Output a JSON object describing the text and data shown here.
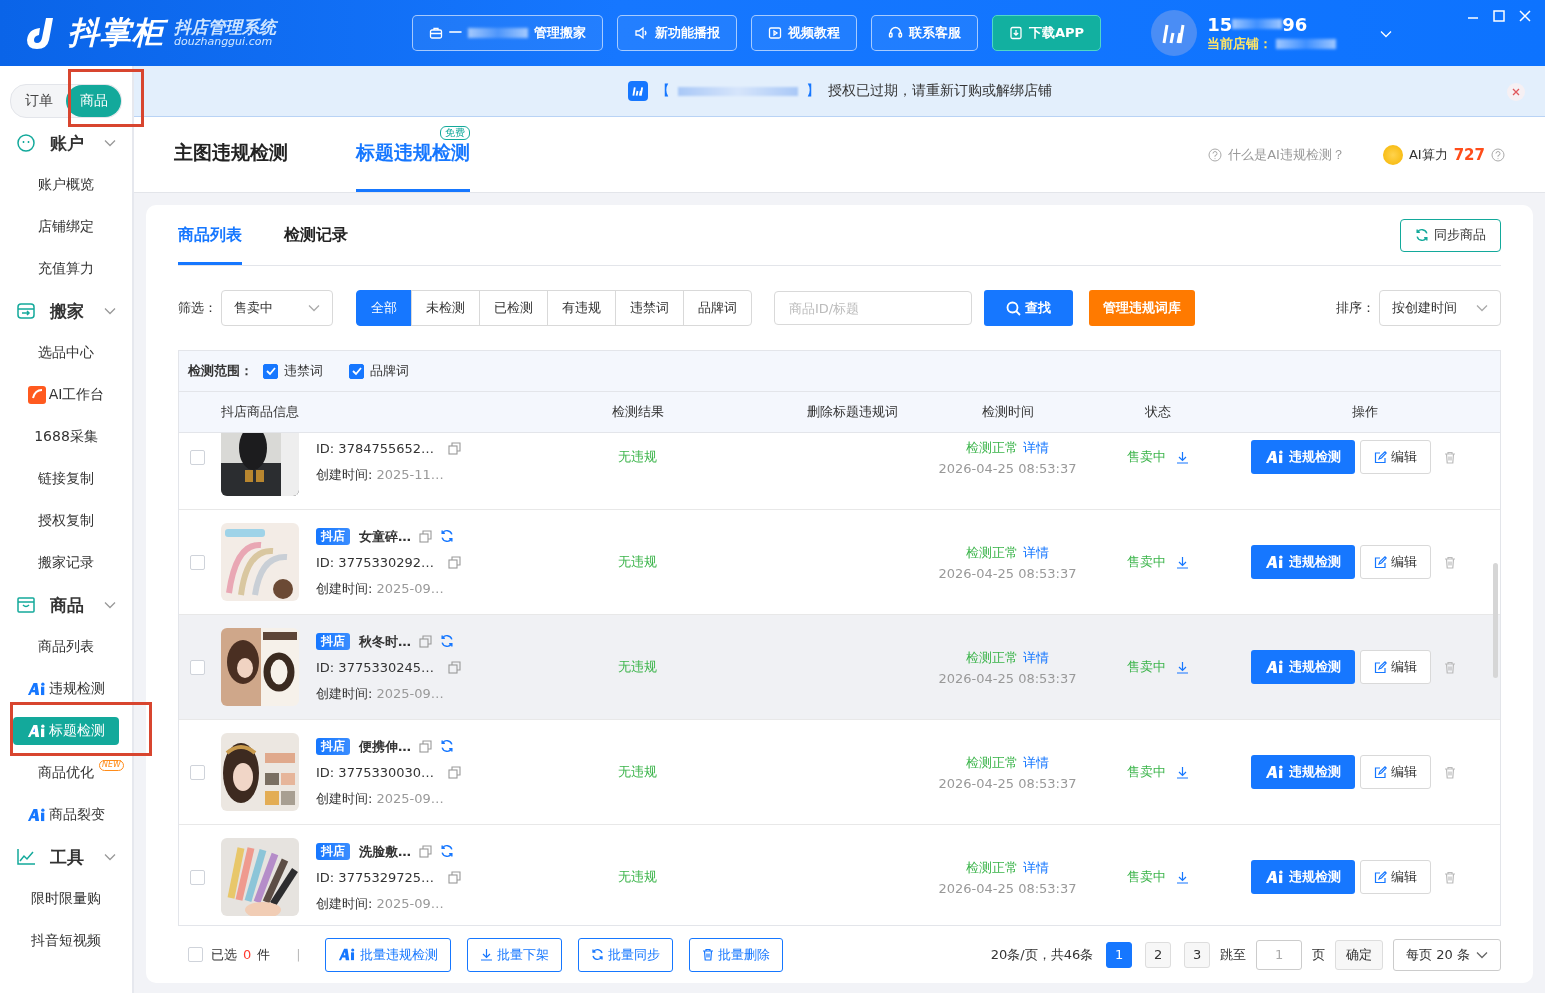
{
  "header": {
    "logo": "抖掌柜",
    "subtitle": "抖店管理系统",
    "domain": "douzhanggui.com",
    "buttons": [
      {
        "label": "一",
        "label_end": "管理搬家",
        "kind": "outline"
      },
      {
        "label": "新功能播报",
        "kind": "outline"
      },
      {
        "label": "视频教程",
        "kind": "outline"
      },
      {
        "label": "联系客服",
        "kind": "outline"
      },
      {
        "label": "下载APP",
        "kind": "primary"
      }
    ],
    "user": {
      "phone_start": "15",
      "phone_end": "96",
      "shop_label": "当前店铺："
    }
  },
  "notice": {
    "open": "【",
    "close": "】",
    "text": "授权已过期，请重新订购或解绑店铺"
  },
  "sidebar": {
    "switch": [
      {
        "label": "订单",
        "selected": false
      },
      {
        "label": "商品",
        "selected": true,
        "highlight": true
      }
    ],
    "groups": [
      {
        "label": "账户",
        "expanded": true,
        "children": [
          {
            "label": "账户概览",
            "selected": false
          },
          {
            "label": "店铺绑定",
            "selected": false
          },
          {
            "label": "充值算力",
            "selected": false
          }
        ]
      },
      {
        "label": "搬家",
        "expanded": true,
        "children": [
          {
            "label": "选品中心",
            "selected": false
          },
          {
            "label": "AI工作台",
            "kind": "brand",
            "selected": false
          },
          {
            "label": "1688采集",
            "selected": false
          },
          {
            "label": "链接复制",
            "selected": false
          },
          {
            "label": "授权复制",
            "selected": false
          },
          {
            "label": "搬家记录",
            "selected": false
          }
        ]
      },
      {
        "label": "商品",
        "expanded": true,
        "children": [
          {
            "label": "商品列表",
            "selected": false
          },
          {
            "label": "违规检测",
            "kind": "ai",
            "selected": false
          },
          {
            "label": "标题检测",
            "kind": "ai",
            "selected": true,
            "highlight": true
          },
          {
            "label": "商品优化",
            "kind": "new",
            "badge": "NEW",
            "selected": false
          },
          {
            "label": "商品裂变",
            "kind": "ai",
            "selected": false
          }
        ]
      },
      {
        "label": "工具",
        "expanded": true,
        "children": [
          {
            "label": "限时限量购",
            "selected": false
          },
          {
            "label": "抖音短视频",
            "selected": false
          }
        ]
      }
    ]
  },
  "page_tabs": [
    {
      "label": "主图违规检测",
      "selected": false
    },
    {
      "label": "标题违规检测",
      "selected": true,
      "badge": "免费"
    }
  ],
  "help_link": "什么是AI违规检测？",
  "ai_power": {
    "label": "AI算力",
    "value": "727"
  },
  "card": {
    "tabs": [
      {
        "label": "商品列表",
        "selected": true
      },
      {
        "label": "检测记录",
        "selected": false
      }
    ],
    "sync_button": "同步商品",
    "filter": {
      "label": "筛选：",
      "select": "售卖中",
      "segments": [
        {
          "label": "全部",
          "selected": true
        },
        {
          "label": "未检测",
          "selected": false
        },
        {
          "label": "已检测",
          "selected": false
        },
        {
          "label": "有违规",
          "selected": false
        },
        {
          "label": "违禁词",
          "selected": false
        },
        {
          "label": "品牌词",
          "selected": false
        }
      ],
      "placeholder": "商品ID/标题",
      "search_button": "查找",
      "manage_button": "管理违规词库",
      "sort_label": "排序：",
      "sort_value": "按创建时间"
    },
    "scope": {
      "label": "检测范围：",
      "options": [
        {
          "label": "违禁词",
          "checked": true
        },
        {
          "label": "品牌词",
          "checked": true
        }
      ]
    },
    "columns": [
      "抖店商品信息",
      "检测结果",
      "删除标题违规词",
      "检测时间",
      "状态",
      "操作"
    ],
    "rows": [
      {
        "checked": false,
        "hovered": false,
        "id": "ID: 3784755652…",
        "created_label": "创建时间: ",
        "created": "2025-11…",
        "result": "无违规",
        "check": "检测正常",
        "detail": "详情",
        "time": "2026-04-25 08:53:37",
        "status": "售卖中",
        "ai_button": "违规检测",
        "edit_button": "编辑"
      },
      {
        "checked": false,
        "hovered": false,
        "badge": "抖店",
        "title": "女童碎…",
        "id": "ID: 3775330292…",
        "created_label": "创建时间: ",
        "created": "2025-09…",
        "result": "无违规",
        "check": "检测正常",
        "detail": "详情",
        "time": "2026-04-25 08:53:37",
        "status": "售卖中",
        "ai_button": "违规检测",
        "edit_button": "编辑"
      },
      {
        "checked": false,
        "hovered": true,
        "badge": "抖店",
        "title": "秋冬时…",
        "id": "ID: 3775330245…",
        "created_label": "创建时间: ",
        "created": "2025-09…",
        "result": "无违规",
        "check": "检测正常",
        "detail": "详情",
        "time": "2026-04-25 08:53:37",
        "status": "售卖中",
        "ai_button": "违规检测",
        "edit_button": "编辑"
      },
      {
        "checked": false,
        "hovered": false,
        "badge": "抖店",
        "title": "便携伸…",
        "id": "ID: 3775330030…",
        "created_label": "创建时间: ",
        "created": "2025-09…",
        "result": "无违规",
        "check": "检测正常",
        "detail": "详情",
        "time": "2026-04-25 08:53:37",
        "status": "售卖中",
        "ai_button": "违规检测",
        "edit_button": "编辑"
      },
      {
        "checked": false,
        "hovered": false,
        "badge": "抖店",
        "title": "洗脸敷…",
        "id": "ID: 3775329725…",
        "created_label": "创建时间: ",
        "created": "2025-09…",
        "result": "无违规",
        "check": "检测正常",
        "detail": "详情",
        "time": "2026-04-25 08:53:37",
        "status": "售卖中",
        "ai_button": "违规检测",
        "edit_button": "编辑"
      }
    ],
    "footer": {
      "select_all_checked": false,
      "selected_label": "已选",
      "selected_count": "0",
      "selected_unit": "件",
      "separator": "|",
      "bulk": [
        "批量违规检测",
        "批量下架",
        "批量同步",
        "批量删除"
      ],
      "summary": "20条/页，共46条",
      "pages": [
        {
          "label": "1",
          "selected": true
        },
        {
          "label": "2",
          "selected": false
        },
        {
          "label": "3",
          "selected": false
        }
      ],
      "jump_label": "跳至",
      "jump_value": "1",
      "page_unit": "页",
      "confirm": "确定",
      "per_page": "每页 20 条"
    }
  }
}
